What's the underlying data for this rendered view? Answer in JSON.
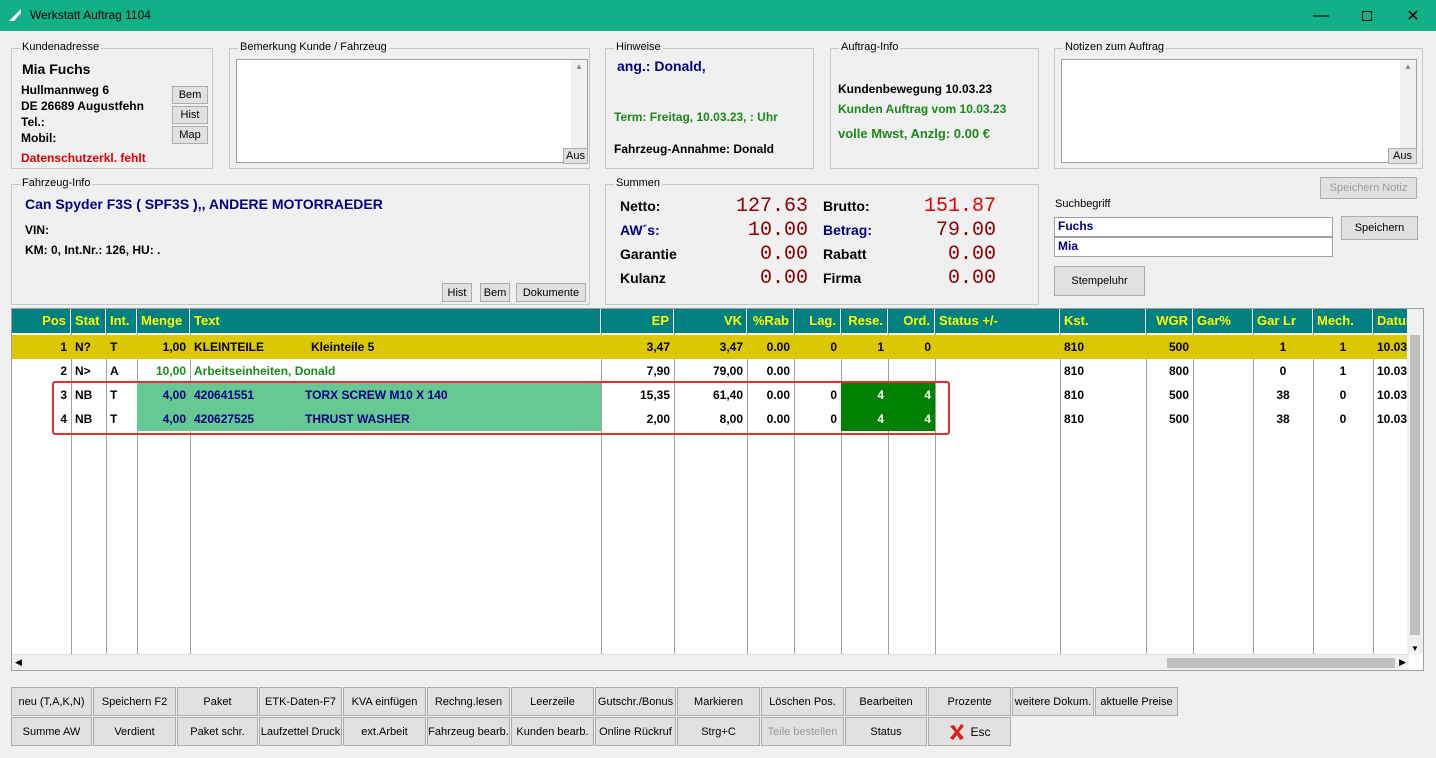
{
  "window": {
    "title": "Werkstatt Auftrag 1104"
  },
  "customer": {
    "legend": "Kundenadresse",
    "name": "Mia Fuchs",
    "street": "Hullmannweg 6",
    "city": "DE 26689 Augustfehn",
    "tel": "Tel.:",
    "mobil": "Mobil:",
    "privacy": "Datenschutzerkl. fehlt",
    "btn_bem": "Bem",
    "btn_hist": "Hist",
    "btn_map": "Map"
  },
  "remark": {
    "legend": "Bemerkung Kunde / Fahrzeug",
    "btn_aus": "Aus"
  },
  "hints": {
    "legend": "Hinweise",
    "ang": "ang.: Donald,",
    "term": "Term: Freitag, 10.03.23,   : Uhr",
    "annahme": "Fahrzeug-Annahme: Donald"
  },
  "order_info": {
    "legend": "Auftrag-Info",
    "bewegung": "Kundenbewegung 10.03.23",
    "auftrag": "Kunden Auftrag vom 10.03.23",
    "mwst": "volle Mwst, Anzlg: 0.00 €"
  },
  "notes": {
    "legend": "Notizen zum Auftrag",
    "btn_aus": "Aus"
  },
  "vehicle": {
    "legend": "Fahrzeug-Info",
    "model": "Can Spyder F3S ( SPF3S ),, ANDERE MOTORRAEDER",
    "vin": "VIN:",
    "km": "KM: 0, Int.Nr.: 126, HU:   .",
    "btn_hist": "Hist",
    "btn_bem": "Bem",
    "btn_docs": "Dokumente"
  },
  "sums": {
    "legend": "Summen",
    "netto_label": "Netto:",
    "netto": "127.63",
    "brutto_label": "Brutto:",
    "brutto": "151.87",
    "aws_label": "AW´s:",
    "aws": "10.00",
    "betrag_label": "Betrag:",
    "betrag": "79.00",
    "garantie_label": "Garantie",
    "garantie": "0.00",
    "rabatt_label": "Rabatt",
    "rabatt": "0.00",
    "kulanz_label": "Kulanz",
    "kulanz": "0.00",
    "firma_label": "Firma",
    "firma": "0.00"
  },
  "search": {
    "btn_save_note": "Speichern Notiz",
    "label": "Suchbegriff",
    "value1": "Fuchs",
    "value2": "Mia",
    "btn_save": "Speichern",
    "btn_clock": "Stempeluhr"
  },
  "grid": {
    "headers": [
      "Pos",
      "Stat",
      "Int.",
      "Menge",
      "Text",
      "EP",
      "VK",
      "%Rab",
      "Lag.",
      "Rese.",
      "Ord.",
      "Status +/-",
      "Kst.",
      "WGR",
      "Gar%",
      "Gar Lr",
      "Mech.",
      "Datum"
    ],
    "rows": [
      [
        "1",
        "N?",
        "T",
        "1,00",
        "KLEINTEILE",
        "Kleinteile 5",
        "3,47",
        "3,47",
        "0.00",
        "0",
        "1",
        "0",
        "",
        "810",
        "500",
        "",
        "1",
        "1",
        "10.03"
      ],
      [
        "2",
        "N>",
        "A",
        "10,00",
        "Arbeitseinheiten, Donald",
        "",
        "7,90",
        "79,00",
        "0.00",
        "",
        "",
        "",
        "",
        "810",
        "800",
        "",
        "0",
        "1",
        "10.03"
      ],
      [
        "3",
        "NB",
        "T",
        "4,00",
        "420641551",
        "TORX SCREW M10 X 140",
        "15,35",
        "61,40",
        "0.00",
        "0",
        "4",
        "4",
        "",
        "810",
        "500",
        "",
        "38",
        "0",
        "10.03"
      ],
      [
        "4",
        "NB",
        "T",
        "4,00",
        "420627525",
        "THRUST WASHER",
        "2,00",
        "8,00",
        "0.00",
        "0",
        "4",
        "4",
        "",
        "810",
        "500",
        "",
        "38",
        "0",
        "10.03"
      ]
    ]
  },
  "toolbar": {
    "row1": [
      "neu (T,A,K,N)",
      "Speichern F2",
      "Paket",
      "ETK-Daten-F7",
      "KVA einfügen",
      "Rechng.lesen",
      "Leerzeile",
      "Gutschr./Bonus",
      "Markieren",
      "Löschen Pos.",
      "Bearbeiten",
      "Prozente",
      "weitere Dokum.",
      "aktuelle Preise"
    ],
    "row2": [
      "Summe AW",
      "Verdient",
      "Paket schr.",
      "Laufzettel Druck",
      "ext.Arbeit",
      "Fahrzeug bearb.",
      "Kunden bearb.",
      "Online Rückruf",
      "Strg+C",
      "Teile bestellen",
      "Status",
      "Esc"
    ]
  },
  "colors": {
    "titlebar": "#12b089",
    "grid_header": "#008080",
    "row_highlight": "#dcc800",
    "green_cell": "#66c994",
    "dark_green_cell": "#008000",
    "selection_frame": "#e03030"
  }
}
